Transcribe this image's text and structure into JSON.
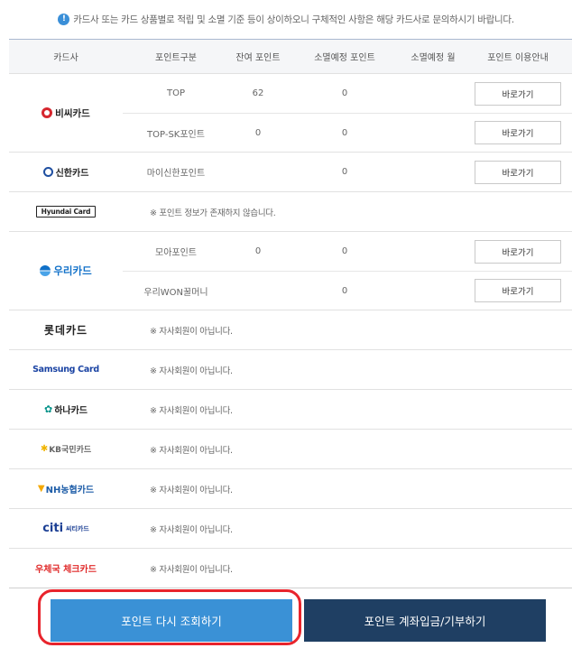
{
  "notice": {
    "icon": "info-icon",
    "text": "카드사 또는 카드 상품별로 적립 및 소멸 기준 등이 상이하오니 구체적인 사항은 해당 카드사로 문의하시기 바랍니다."
  },
  "table": {
    "headers": [
      "카드사",
      "포인트구분",
      "잔여 포인트",
      "소멸예정 포인트",
      "소멸예정 월",
      "포인트 이용안내"
    ],
    "go_label": "바로가기",
    "no_info_msg": "※ 포인트 정보가 존재하지 않습니다.",
    "not_member_msg": "※ 자사회원이 아닙니다."
  },
  "cards": {
    "bc": {
      "logo_text": "비씨카드",
      "rows": [
        {
          "type": "TOP",
          "balance": "62",
          "expiring": "0",
          "month": ""
        },
        {
          "type": "TOP-SK포인트",
          "balance": "0",
          "expiring": "0",
          "month": ""
        }
      ]
    },
    "shinhan": {
      "logo_text": "신한카드",
      "rows": [
        {
          "type": "마이신한포인트",
          "balance": "",
          "expiring": "0",
          "month": ""
        }
      ]
    },
    "hyundai": {
      "logo_text": "Hyundai Card"
    },
    "woori": {
      "logo_text": "우리카드",
      "rows": [
        {
          "type": "모아포인트",
          "balance": "0",
          "expiring": "0",
          "month": ""
        },
        {
          "type": "우리WON꿀머니",
          "balance": "",
          "expiring": "0",
          "month": ""
        }
      ]
    },
    "lotte": {
      "logo_text": "롯데카드"
    },
    "samsung": {
      "logo_text": "Samsung Card"
    },
    "hana": {
      "logo_text": "하나카드"
    },
    "kb": {
      "logo_text": "KB국민카드"
    },
    "nh": {
      "logo_text": "NH농협카드"
    },
    "citi": {
      "logo_text": "citi",
      "logo_sub": "씨티카드"
    },
    "post": {
      "logo_text": "우체국 체크카드"
    }
  },
  "buttons": {
    "refresh": "포인트 다시 조회하기",
    "transfer": "포인트 계좌입금/기부하기"
  },
  "colors": {
    "primary_button": "#3a91d6",
    "secondary_button": "#1f3f63",
    "highlight": "#e8242c"
  }
}
